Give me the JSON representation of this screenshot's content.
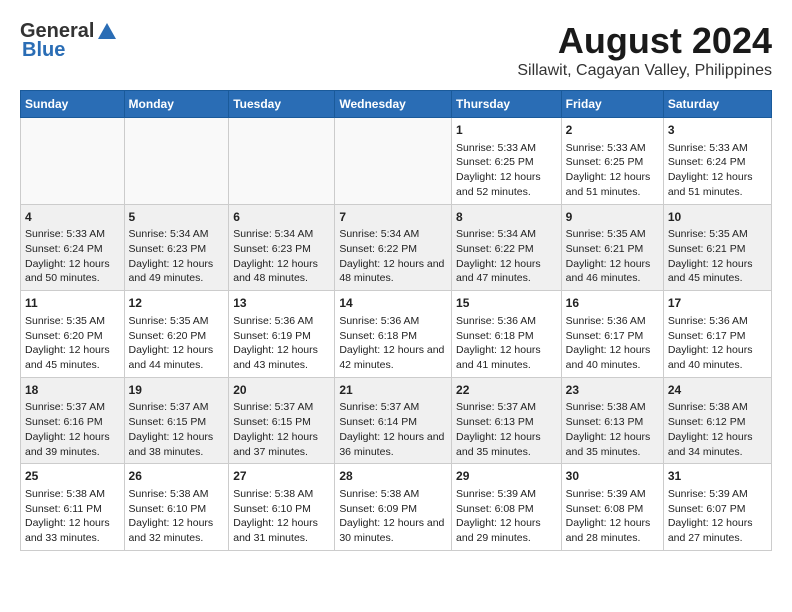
{
  "header": {
    "logo_general": "General",
    "logo_blue": "Blue",
    "main_title": "August 2024",
    "subtitle": "Sillawit, Cagayan Valley, Philippines"
  },
  "weekdays": [
    "Sunday",
    "Monday",
    "Tuesday",
    "Wednesday",
    "Thursday",
    "Friday",
    "Saturday"
  ],
  "weeks": [
    [
      {
        "day": "",
        "sunrise": "",
        "sunset": "",
        "daylight": ""
      },
      {
        "day": "",
        "sunrise": "",
        "sunset": "",
        "daylight": ""
      },
      {
        "day": "",
        "sunrise": "",
        "sunset": "",
        "daylight": ""
      },
      {
        "day": "",
        "sunrise": "",
        "sunset": "",
        "daylight": ""
      },
      {
        "day": "1",
        "sunrise": "Sunrise: 5:33 AM",
        "sunset": "Sunset: 6:25 PM",
        "daylight": "Daylight: 12 hours and 52 minutes."
      },
      {
        "day": "2",
        "sunrise": "Sunrise: 5:33 AM",
        "sunset": "Sunset: 6:25 PM",
        "daylight": "Daylight: 12 hours and 51 minutes."
      },
      {
        "day": "3",
        "sunrise": "Sunrise: 5:33 AM",
        "sunset": "Sunset: 6:24 PM",
        "daylight": "Daylight: 12 hours and 51 minutes."
      }
    ],
    [
      {
        "day": "4",
        "sunrise": "Sunrise: 5:33 AM",
        "sunset": "Sunset: 6:24 PM",
        "daylight": "Daylight: 12 hours and 50 minutes."
      },
      {
        "day": "5",
        "sunrise": "Sunrise: 5:34 AM",
        "sunset": "Sunset: 6:23 PM",
        "daylight": "Daylight: 12 hours and 49 minutes."
      },
      {
        "day": "6",
        "sunrise": "Sunrise: 5:34 AM",
        "sunset": "Sunset: 6:23 PM",
        "daylight": "Daylight: 12 hours and 48 minutes."
      },
      {
        "day": "7",
        "sunrise": "Sunrise: 5:34 AM",
        "sunset": "Sunset: 6:22 PM",
        "daylight": "Daylight: 12 hours and 48 minutes."
      },
      {
        "day": "8",
        "sunrise": "Sunrise: 5:34 AM",
        "sunset": "Sunset: 6:22 PM",
        "daylight": "Daylight: 12 hours and 47 minutes."
      },
      {
        "day": "9",
        "sunrise": "Sunrise: 5:35 AM",
        "sunset": "Sunset: 6:21 PM",
        "daylight": "Daylight: 12 hours and 46 minutes."
      },
      {
        "day": "10",
        "sunrise": "Sunrise: 5:35 AM",
        "sunset": "Sunset: 6:21 PM",
        "daylight": "Daylight: 12 hours and 45 minutes."
      }
    ],
    [
      {
        "day": "11",
        "sunrise": "Sunrise: 5:35 AM",
        "sunset": "Sunset: 6:20 PM",
        "daylight": "Daylight: 12 hours and 45 minutes."
      },
      {
        "day": "12",
        "sunrise": "Sunrise: 5:35 AM",
        "sunset": "Sunset: 6:20 PM",
        "daylight": "Daylight: 12 hours and 44 minutes."
      },
      {
        "day": "13",
        "sunrise": "Sunrise: 5:36 AM",
        "sunset": "Sunset: 6:19 PM",
        "daylight": "Daylight: 12 hours and 43 minutes."
      },
      {
        "day": "14",
        "sunrise": "Sunrise: 5:36 AM",
        "sunset": "Sunset: 6:18 PM",
        "daylight": "Daylight: 12 hours and 42 minutes."
      },
      {
        "day": "15",
        "sunrise": "Sunrise: 5:36 AM",
        "sunset": "Sunset: 6:18 PM",
        "daylight": "Daylight: 12 hours and 41 minutes."
      },
      {
        "day": "16",
        "sunrise": "Sunrise: 5:36 AM",
        "sunset": "Sunset: 6:17 PM",
        "daylight": "Daylight: 12 hours and 40 minutes."
      },
      {
        "day": "17",
        "sunrise": "Sunrise: 5:36 AM",
        "sunset": "Sunset: 6:17 PM",
        "daylight": "Daylight: 12 hours and 40 minutes."
      }
    ],
    [
      {
        "day": "18",
        "sunrise": "Sunrise: 5:37 AM",
        "sunset": "Sunset: 6:16 PM",
        "daylight": "Daylight: 12 hours and 39 minutes."
      },
      {
        "day": "19",
        "sunrise": "Sunrise: 5:37 AM",
        "sunset": "Sunset: 6:15 PM",
        "daylight": "Daylight: 12 hours and 38 minutes."
      },
      {
        "day": "20",
        "sunrise": "Sunrise: 5:37 AM",
        "sunset": "Sunset: 6:15 PM",
        "daylight": "Daylight: 12 hours and 37 minutes."
      },
      {
        "day": "21",
        "sunrise": "Sunrise: 5:37 AM",
        "sunset": "Sunset: 6:14 PM",
        "daylight": "Daylight: 12 hours and 36 minutes."
      },
      {
        "day": "22",
        "sunrise": "Sunrise: 5:37 AM",
        "sunset": "Sunset: 6:13 PM",
        "daylight": "Daylight: 12 hours and 35 minutes."
      },
      {
        "day": "23",
        "sunrise": "Sunrise: 5:38 AM",
        "sunset": "Sunset: 6:13 PM",
        "daylight": "Daylight: 12 hours and 35 minutes."
      },
      {
        "day": "24",
        "sunrise": "Sunrise: 5:38 AM",
        "sunset": "Sunset: 6:12 PM",
        "daylight": "Daylight: 12 hours and 34 minutes."
      }
    ],
    [
      {
        "day": "25",
        "sunrise": "Sunrise: 5:38 AM",
        "sunset": "Sunset: 6:11 PM",
        "daylight": "Daylight: 12 hours and 33 minutes."
      },
      {
        "day": "26",
        "sunrise": "Sunrise: 5:38 AM",
        "sunset": "Sunset: 6:10 PM",
        "daylight": "Daylight: 12 hours and 32 minutes."
      },
      {
        "day": "27",
        "sunrise": "Sunrise: 5:38 AM",
        "sunset": "Sunset: 6:10 PM",
        "daylight": "Daylight: 12 hours and 31 minutes."
      },
      {
        "day": "28",
        "sunrise": "Sunrise: 5:38 AM",
        "sunset": "Sunset: 6:09 PM",
        "daylight": "Daylight: 12 hours and 30 minutes."
      },
      {
        "day": "29",
        "sunrise": "Sunrise: 5:39 AM",
        "sunset": "Sunset: 6:08 PM",
        "daylight": "Daylight: 12 hours and 29 minutes."
      },
      {
        "day": "30",
        "sunrise": "Sunrise: 5:39 AM",
        "sunset": "Sunset: 6:08 PM",
        "daylight": "Daylight: 12 hours and 28 minutes."
      },
      {
        "day": "31",
        "sunrise": "Sunrise: 5:39 AM",
        "sunset": "Sunset: 6:07 PM",
        "daylight": "Daylight: 12 hours and 27 minutes."
      }
    ]
  ]
}
